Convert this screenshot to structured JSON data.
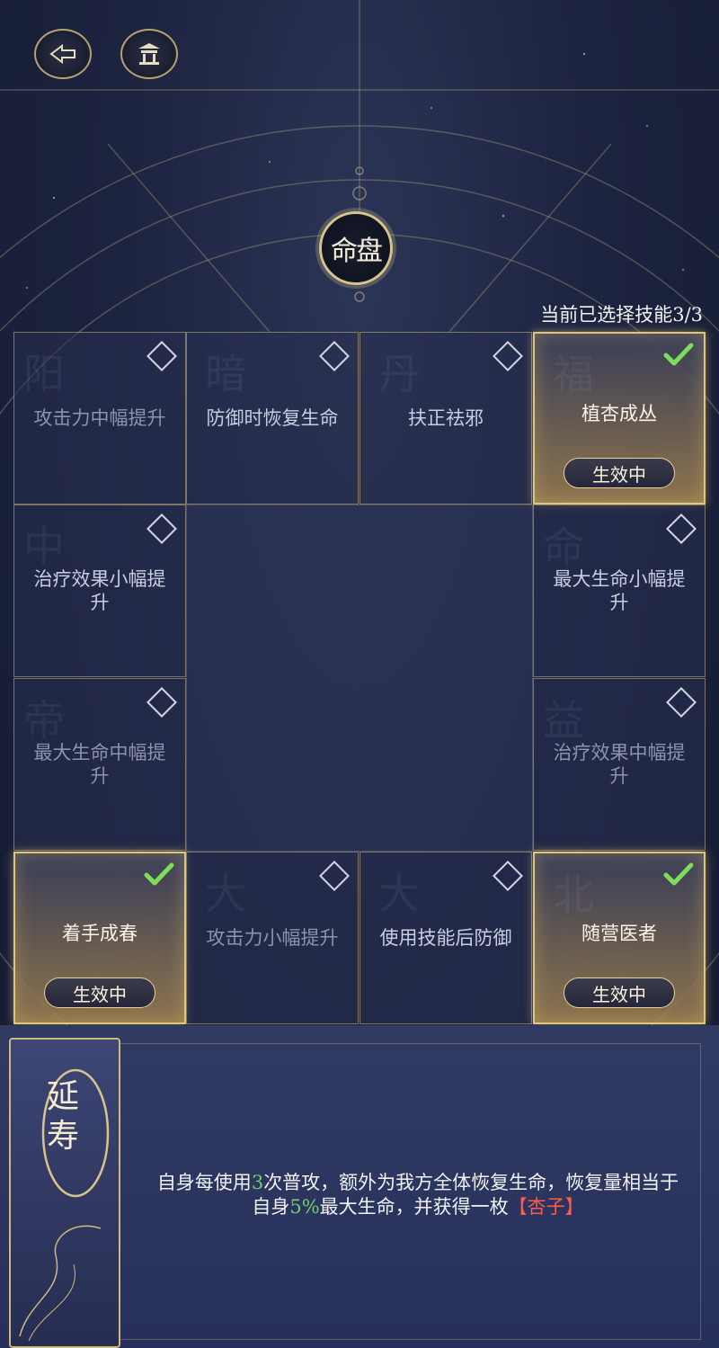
{
  "header": {
    "back_icon": "back-arrow-icon",
    "home_icon": "pavilion-icon"
  },
  "seal": {
    "title": "命盘"
  },
  "selection": {
    "count_text": "当前已选择技能3/3"
  },
  "cells": [
    {
      "label": "攻击力中幅提升",
      "state": "dim-unselected",
      "bgchar": "阳"
    },
    {
      "label": "防御时恢复生命",
      "state": "unselected",
      "bgchar": "暗"
    },
    {
      "label": "扶正祛邪",
      "state": "unselected",
      "bgchar": "丹"
    },
    {
      "label": "植杏成丛",
      "state": "active",
      "badge": "生效中",
      "bgchar": "福"
    },
    {
      "label": "治疗效果小幅提升",
      "state": "unselected",
      "bgchar": "中"
    },
    {
      "label": "最大生命小幅提升",
      "state": "unselected",
      "bgchar": "命"
    },
    {
      "label": "最大生命中幅提升",
      "state": "dim-unselected",
      "bgchar": "帝"
    },
    {
      "label": "治疗效果中幅提升",
      "state": "dim-unselected",
      "bgchar": "益"
    },
    {
      "label": "着手成春",
      "state": "active",
      "badge": "生效中",
      "bgchar": ""
    },
    {
      "label": "攻击力小幅提升",
      "state": "dim-unselected",
      "bgchar": "大"
    },
    {
      "label": "使用技能后防御",
      "state": "unselected",
      "bgchar": "大"
    },
    {
      "label": "随营医者",
      "state": "active",
      "badge": "生效中",
      "bgchar": "北"
    }
  ],
  "skill_detail": {
    "name": "延寿",
    "desc_part1": "自身每使用",
    "desc_num1": "3",
    "desc_part2": "次普攻，额外为我方全体恢复生命，恢复量相当于自身",
    "desc_num2": "5%",
    "desc_part3": "最大生命，并获得一枚",
    "desc_item": "【杏子】"
  },
  "colors": {
    "gold": "#e2c675",
    "check_green": "#7ddc5a",
    "highlight_green": "#6fcf6a",
    "highlight_red": "#ff5a4a"
  }
}
